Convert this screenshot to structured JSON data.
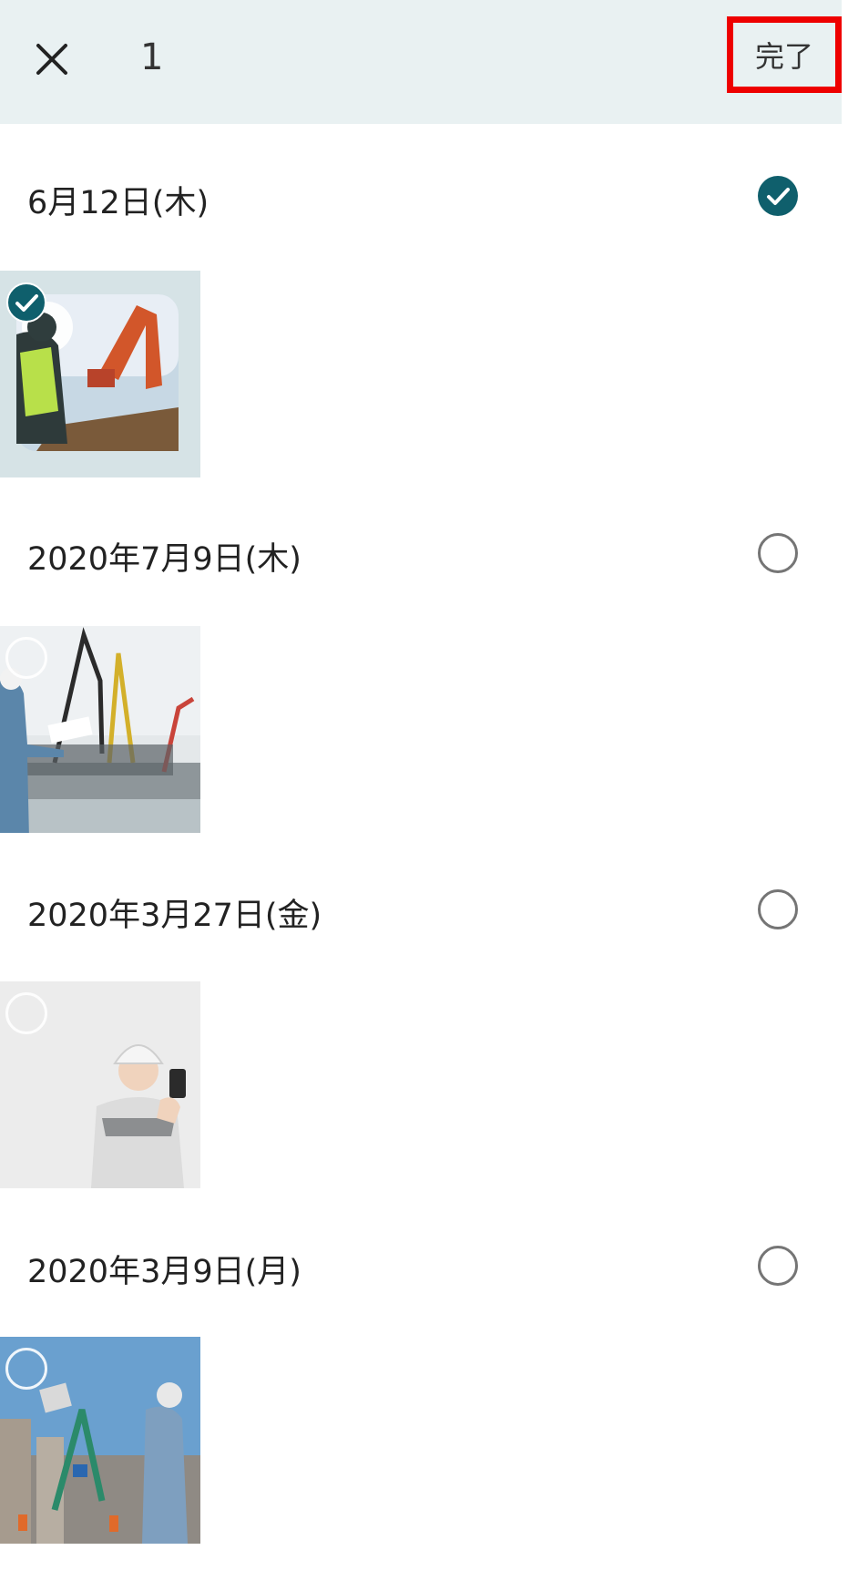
{
  "header": {
    "selected_count": "1",
    "done_label": "完了",
    "close_icon": "close-icon"
  },
  "groups": [
    {
      "date": "6月12日(木)",
      "selected": true,
      "photo": "excavator-worker-photo"
    },
    {
      "date": "2020年7月9日(木)",
      "selected": false,
      "photo": "pump-truck-worker-photo"
    },
    {
      "date": "2020年3月27日(金)",
      "selected": false,
      "photo": "woman-with-phone-photo"
    },
    {
      "date": "2020年3月9日(月)",
      "selected": false,
      "photo": "street-crane-worker-photo"
    }
  ],
  "colors": {
    "header_bg": "#e9f1f2",
    "check_accent": "#0f5f6c",
    "highlight_border": "#ee0000"
  }
}
